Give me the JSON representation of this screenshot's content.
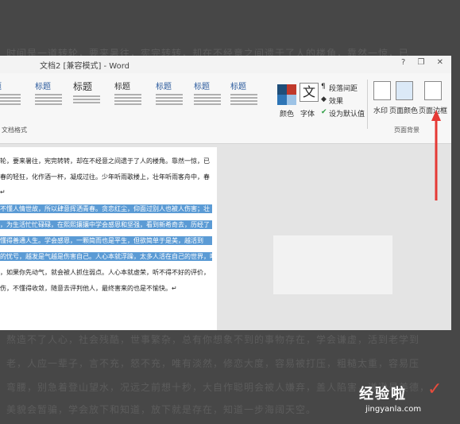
{
  "background_text": {
    "top": "时间是一道转轮，要来暑往，宪完转转，却在不经意之间遗于了人的楼角，靠然一惊，已",
    "bottom_lines": [
      "熬造不了人心，社会残酷，世事繁杂，总有你想象不到的事物存在，学会谦虚，活到老学到",
      "老，人应一辈子，言不充，怒不充，唯有淡然，修恋大度，容易被打压，粗糙太重，容易压",
      "弯腰，别急着登山望水，况远之前想十秒，大自作聪明会被人嫌弃，盖人陷害，谦逊是美德，",
      "美貌会暂骗，学会放下和知道，放下就是存在，知道一步海阔天空。"
    ]
  },
  "window": {
    "title": "文档2 [兼容模式] - Word",
    "icons": [
      "help-icon",
      "restore-icon",
      "close-icon"
    ],
    "help_glyph": "?",
    "restore_glyph": "❐",
    "close_glyph": "✕"
  },
  "ribbon": {
    "styles": [
      {
        "heading": "题"
      },
      {
        "heading": "标题"
      },
      {
        "heading": "标题"
      },
      {
        "heading": "标题"
      },
      {
        "heading": "标题"
      },
      {
        "heading": "标题"
      },
      {
        "heading": "标题"
      }
    ],
    "doc_format_label": "文档格式",
    "colors_label": "颜色",
    "fonts_label": "字体",
    "font_icon_glyph": "文",
    "paragraph_spacing": "段落间距",
    "effects": "效果",
    "set_default": "设为默认值",
    "watermark": "水印",
    "page_color": "页面颜色",
    "page_border": "页面边框",
    "page_background_label": "页面背景"
  },
  "document": {
    "lines": [
      {
        "text": "轮，要来暑往，宪完转转，却在不经意之间遗于了人的楼角。靠然一惊，已",
        "highlight": false
      },
      {
        "text": "春的轻狂，化作酒一杯，凝成过往。少年听雨歌楼上，壮年听雨客舟中，春",
        "highlight": false
      },
      {
        "text": "↵",
        "highlight": false
      },
      {
        "text": "不懂人情世故，所以肆意挥洒青春。贪恋红尘，仰面过别人也被人伤害；壮",
        "highlight": true
      },
      {
        "text": "，为生活忙忙碌碌，在熙熙攘攘中学会感恩和坚强，看到新希奇去，历经了",
        "highlight": true
      },
      {
        "text": "懂得善通人生。学会感恩，一颗简而也是平生，但欲简单于是美，越活到",
        "highlight": true
      },
      {
        "text": "的忧亏，越发是气越是伤害自己。人心本就浮躁，太多人活在自己的世界，听",
        "highlight": true
      },
      {
        "text": "，如果你先动气，就会被人抓住弱点。人心本就虚荣，听不得不好的评价，",
        "highlight": false
      },
      {
        "text": "伤，不懂得收敛，随意去评判他人，最终害来的也是不愉快。↵",
        "highlight": false
      }
    ]
  },
  "watermark": {
    "text": "经验啦",
    "check": "✓",
    "url": "jingyanla.com"
  },
  "colors": {
    "highlight": "#5b9bd5",
    "arrow": "#e53935"
  }
}
